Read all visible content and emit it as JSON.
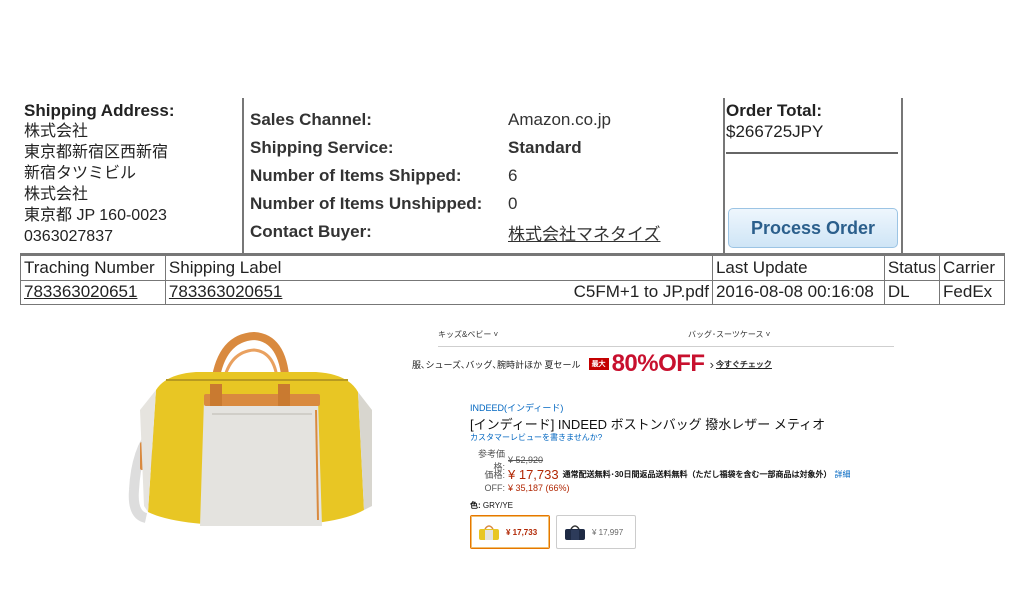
{
  "order": {
    "address": {
      "heading": "Shipping Address:",
      "lines": [
        "株式会社",
        "東京都新宿区西新宿",
        "新宿タツミビル",
        "株式会社",
        "東京都 JP 160-0023",
        "0363027837"
      ]
    },
    "details": [
      {
        "key": "Sales Channel:",
        "value": "Amazon.co.jp"
      },
      {
        "key": "Shipping Service:",
        "value": "Standard"
      },
      {
        "key": "Number of Items Shipped:",
        "value": "6"
      },
      {
        "key": "Number of Items Unshipped:",
        "value": "0"
      },
      {
        "key": "Contact Buyer:",
        "value": "株式会社マネタイズ"
      }
    ],
    "total": {
      "heading": "Order Total:",
      "value": "$266725JPY"
    },
    "process_button": "Process Order",
    "table": {
      "headers": [
        "Traching Number",
        "Shipping Label",
        "Last Update",
        "Status",
        "Carrier"
      ],
      "row": {
        "tracking": "783363020651",
        "label": "783363020651",
        "label_file": "C5FM+1  to  JP.pdf",
        "last_update": "2016-08-08 00:16:08",
        "status": "DL",
        "carrier": "FedEx"
      }
    }
  },
  "product": {
    "categories": [
      "キッズ&ベビー ˅",
      "バッグ･スーツケース ˅"
    ],
    "promo": {
      "text": "服､シューズ､バッグ､腕時計ほか 夏セール",
      "badge": "最大",
      "big": "80%OFF",
      "arrow": "›",
      "link": "今すぐチェック"
    },
    "brand": "INDEED(インディード)",
    "title": "[インディード] INDEED ボストンバッグ 撥水レザー メティオ",
    "review_link": "カスタマーレビューを書きませんか?",
    "price_table": {
      "ref_label": "参考価格:",
      "ref_price": "¥ 52,920",
      "price_label": "価格:",
      "price": "¥ 17,733",
      "shipping_note": "通常配送無料･30日間返品送料無料（ただし福袋を含む一部商品は対象外）",
      "detail_link": "詳細",
      "off_label": "OFF:",
      "off_value": "¥ 35,187 (66%)"
    },
    "color": {
      "label": "色:",
      "value": "GRY/YE"
    },
    "variants": [
      {
        "price": "¥ 17,733",
        "selected": true,
        "icon": "yellow-bag-thumbnail"
      },
      {
        "price": "¥ 17,997",
        "selected": false,
        "icon": "navy-bag-thumbnail"
      }
    ],
    "image_icon": "yellow-gray-boston-bag"
  }
}
